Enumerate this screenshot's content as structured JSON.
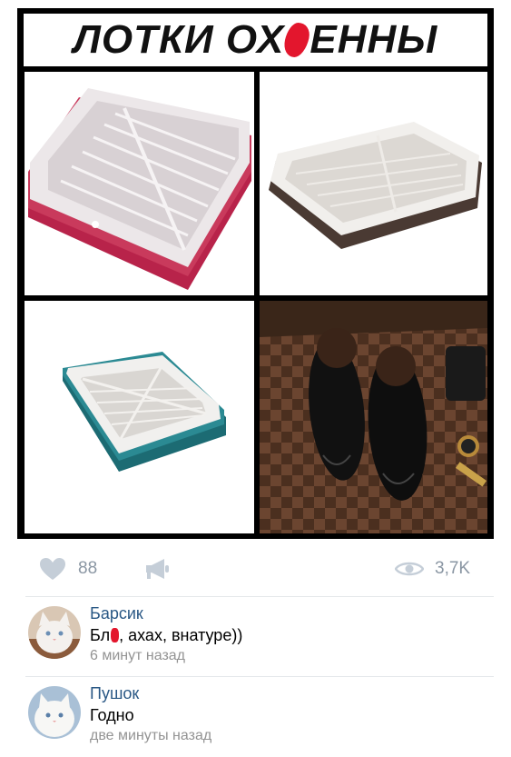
{
  "meme": {
    "title_part1": "ЛОТКИ ОХ",
    "title_part2": "ЕННЫ",
    "censor_color": "#e3162d",
    "panels": [
      {
        "name": "litter-tray-pink"
      },
      {
        "name": "litter-tray-brown"
      },
      {
        "name": "litter-tray-teal"
      },
      {
        "name": "black-shoes"
      }
    ]
  },
  "actions": {
    "like_icon": "heart-icon",
    "likes": "88",
    "share_icon": "megaphone-icon",
    "views_icon": "eye-icon",
    "views": "3,7K"
  },
  "comments": [
    {
      "author": "Барсик",
      "text_before": "Бл",
      "text_after": ", ахах, внатуре))",
      "time": "6 минут назад",
      "avatar": "white-cat-avatar"
    },
    {
      "author": "Пушок",
      "text": "Годно",
      "time": "две минуты назад",
      "avatar": "white-kitten-avatar"
    }
  ],
  "colors": {
    "link": "#2a5885",
    "muted": "#8a96a3",
    "time": "#939393"
  }
}
